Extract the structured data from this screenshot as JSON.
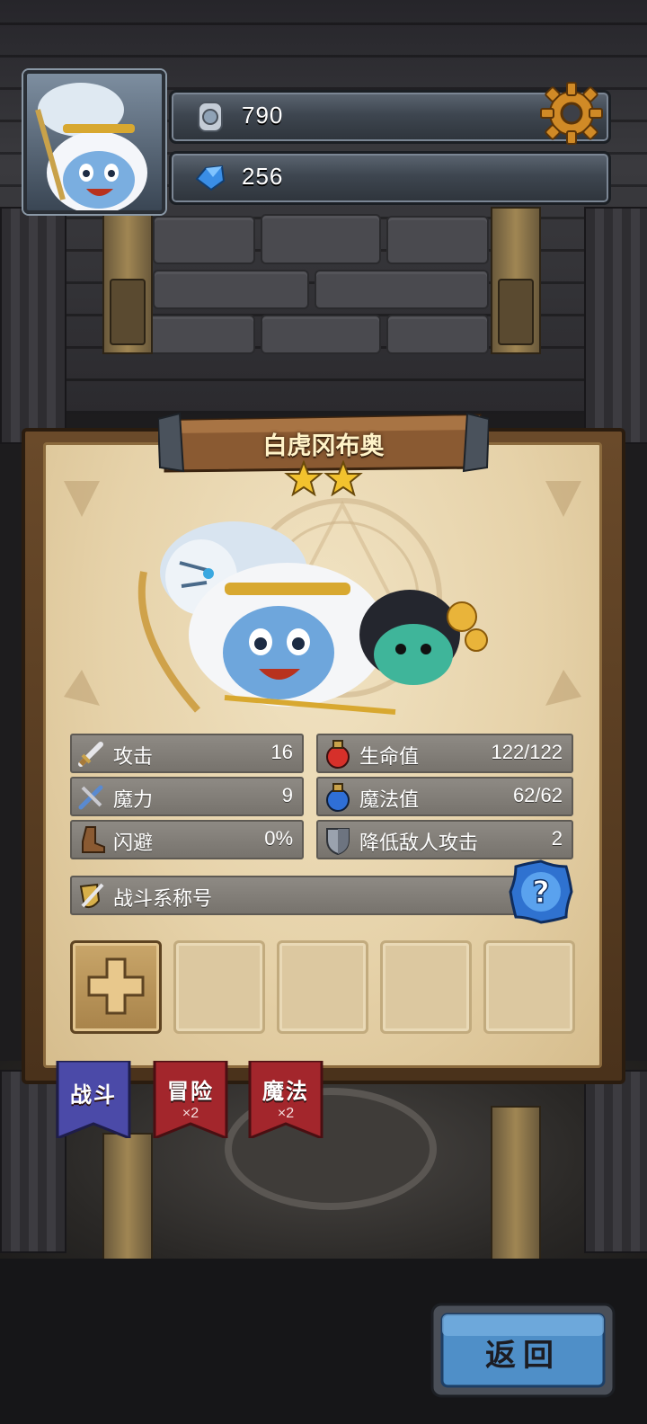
{
  "resources": {
    "silver": {
      "icon": "silver-coin-icon",
      "value": "790"
    },
    "gems": {
      "icon": "blue-crystal-icon",
      "value": "256"
    }
  },
  "settings_icon": "gear-icon",
  "hero": {
    "name": "白虎冈布奥",
    "stars": 2
  },
  "stats": {
    "attack": {
      "icon": "sword-icon",
      "label": "攻击",
      "value": "16"
    },
    "hp": {
      "icon": "red-potion-icon",
      "label": "生命值",
      "value": "122/122"
    },
    "magic_power": {
      "icon": "wand-icon",
      "label": "魔力",
      "value": "9"
    },
    "mp": {
      "icon": "blue-potion-icon",
      "label": "魔法值",
      "value": "62/62"
    },
    "dodge": {
      "icon": "boot-icon",
      "label": "闪避",
      "value": "0%"
    },
    "reduce_attack": {
      "icon": "shield-icon",
      "label": "降低敌人攻击",
      "value": "2"
    }
  },
  "combat_title": {
    "icon": "sword-shield-icon",
    "label": "战斗系称号"
  },
  "help_icon": "question-icon",
  "slots": [
    "add",
    "empty",
    "empty",
    "empty",
    "empty"
  ],
  "tabs": [
    {
      "label": "战斗",
      "sub": "",
      "color": "#4b4aa8"
    },
    {
      "label": "冒险",
      "sub": "×2",
      "color": "#a3262c"
    },
    {
      "label": "魔法",
      "sub": "×2",
      "color": "#a3262c"
    }
  ],
  "back_button": {
    "label": "返回"
  },
  "colors": {
    "panel_parchment": "#e6d2a9",
    "stat_bar": "#8e8a84",
    "back_button": "#4f8fc8",
    "gear": "#d08a26"
  }
}
